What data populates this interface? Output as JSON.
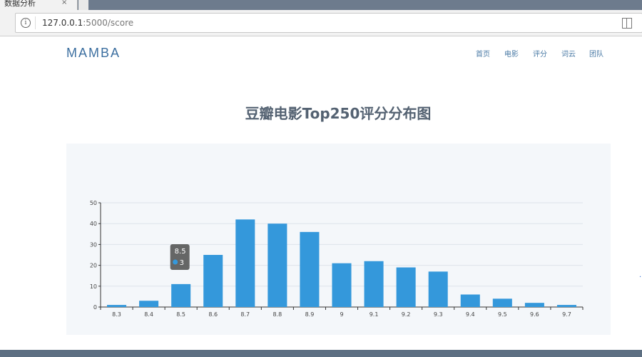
{
  "browser": {
    "tab_title": "数据分析",
    "tab_close": "×",
    "url_host": "127.0.0.1",
    "url_path": ":5000/score"
  },
  "site": {
    "brand": "MAMBA",
    "nav": [
      "首页",
      "电影",
      "评分",
      "词云",
      "团队"
    ]
  },
  "page_title": "豆瓣电影Top250评分分布图",
  "chart_data": {
    "type": "bar",
    "categories": [
      "8.3",
      "8.4",
      "8.5",
      "8.6",
      "8.7",
      "8.8",
      "8.9",
      "9",
      "9.1",
      "9.2",
      "9.3",
      "9.4",
      "9.5",
      "9.6",
      "9.7"
    ],
    "values": [
      1,
      3,
      11,
      25,
      42,
      40,
      36,
      21,
      22,
      19,
      17,
      6,
      4,
      2,
      1
    ],
    "ylim": [
      0,
      50
    ],
    "yticks": [
      0,
      10,
      20,
      30,
      40,
      50
    ],
    "grid": true,
    "color": "#3498db",
    "tooltip": {
      "category": "8.5",
      "value": "3"
    }
  },
  "colors": {
    "accent": "#3c6fa0",
    "bar": "#3498db",
    "footer": "#5d6f82"
  }
}
